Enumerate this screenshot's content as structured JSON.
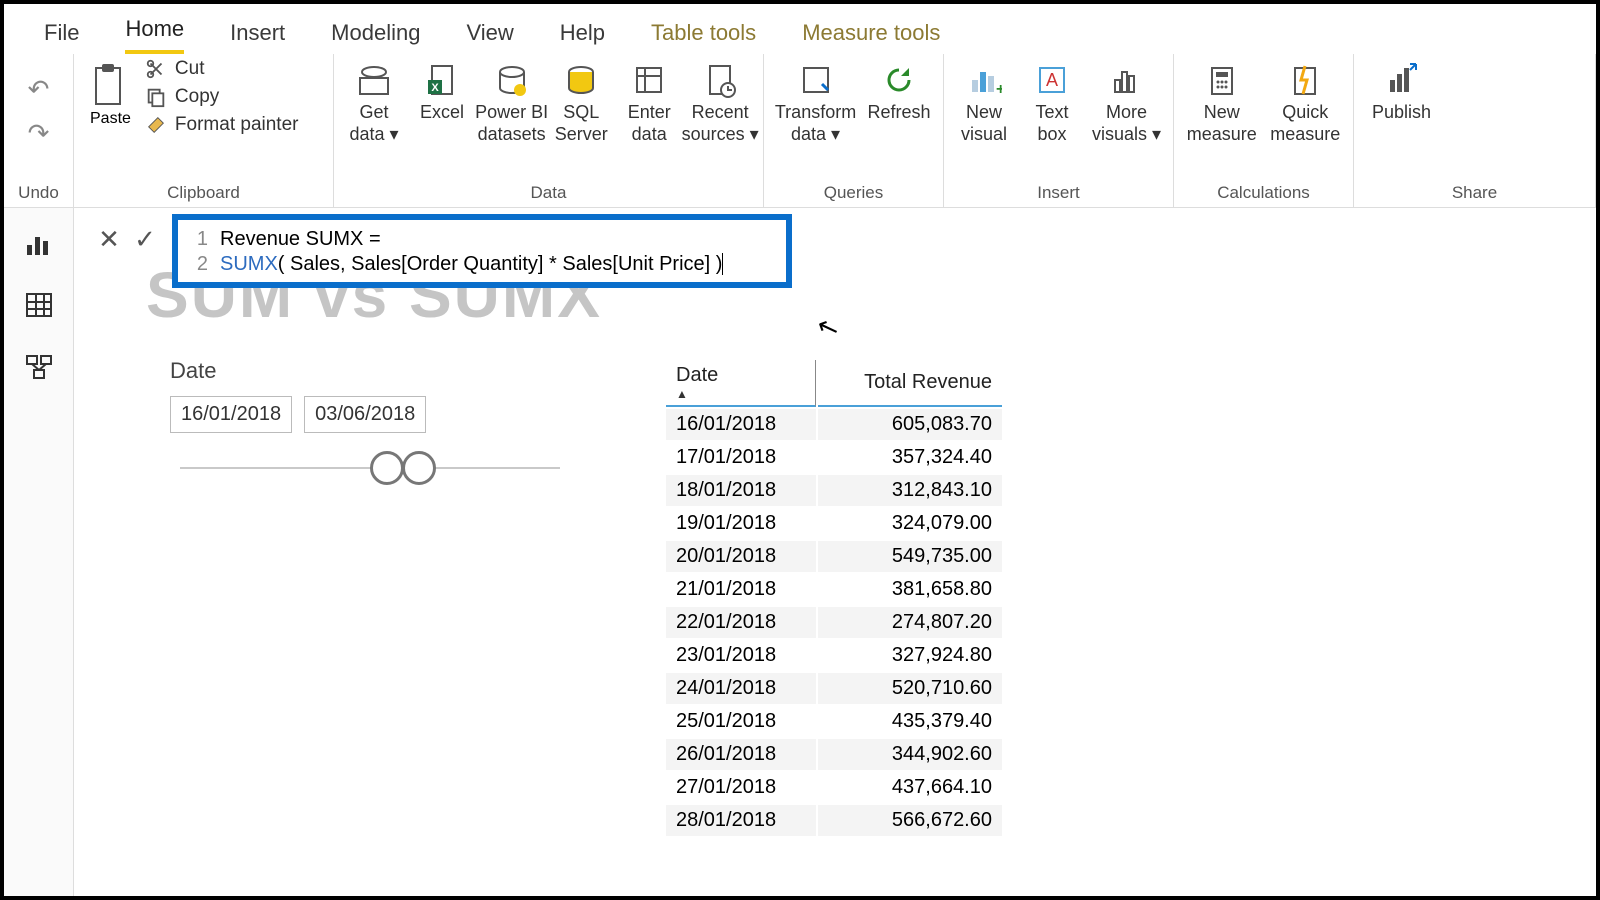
{
  "menubar": {
    "tabs": [
      "File",
      "Home",
      "Insert",
      "Modeling",
      "View",
      "Help",
      "Table tools",
      "Measure tools"
    ],
    "active": "Home",
    "context_start_index": 6
  },
  "ribbon": {
    "undo_label": "Undo",
    "clipboard": {
      "paste": "Paste",
      "cut": "Cut",
      "copy": "Copy",
      "format_painter": "Format painter",
      "label": "Clipboard"
    },
    "data": {
      "get_data": "Get\ndata ▾",
      "excel": "Excel",
      "pbi_datasets": "Power BI\ndatasets",
      "sql": "SQL\nServer",
      "enter": "Enter\ndata",
      "recent": "Recent\nsources ▾",
      "label": "Data"
    },
    "queries": {
      "transform": "Transform\ndata ▾",
      "refresh": "Refresh",
      "label": "Queries"
    },
    "insert": {
      "new_visual": "New\nvisual",
      "text_box": "Text\nbox",
      "more_visuals": "More\nvisuals ▾",
      "label": "Insert"
    },
    "calc": {
      "new_measure": "New\nmeasure",
      "quick_measure": "Quick\nmeasure",
      "label": "Calculations"
    },
    "share": {
      "publish": "Publish",
      "label": "Share"
    }
  },
  "formula": {
    "line1": "Revenue SUMX =",
    "line2_kw": "SUMX",
    "line2_rest": "( Sales, Sales[Order Quantity] * Sales[Unit Price] )"
  },
  "canvas_title": "SUM vs SUMX",
  "slicer": {
    "title": "Date",
    "from": "16/01/2018",
    "to": "03/06/2018"
  },
  "table": {
    "headers": [
      "Date",
      "Total Revenue"
    ],
    "rows": [
      [
        "16/01/2018",
        "605,083.70"
      ],
      [
        "17/01/2018",
        "357,324.40"
      ],
      [
        "18/01/2018",
        "312,843.10"
      ],
      [
        "19/01/2018",
        "324,079.00"
      ],
      [
        "20/01/2018",
        "549,735.00"
      ],
      [
        "21/01/2018",
        "381,658.80"
      ],
      [
        "22/01/2018",
        "274,807.20"
      ],
      [
        "23/01/2018",
        "327,924.80"
      ],
      [
        "24/01/2018",
        "520,710.60"
      ],
      [
        "25/01/2018",
        "435,379.40"
      ],
      [
        "26/01/2018",
        "344,902.60"
      ],
      [
        "27/01/2018",
        "437,664.10"
      ],
      [
        "28/01/2018",
        "566,672.60"
      ]
    ]
  }
}
